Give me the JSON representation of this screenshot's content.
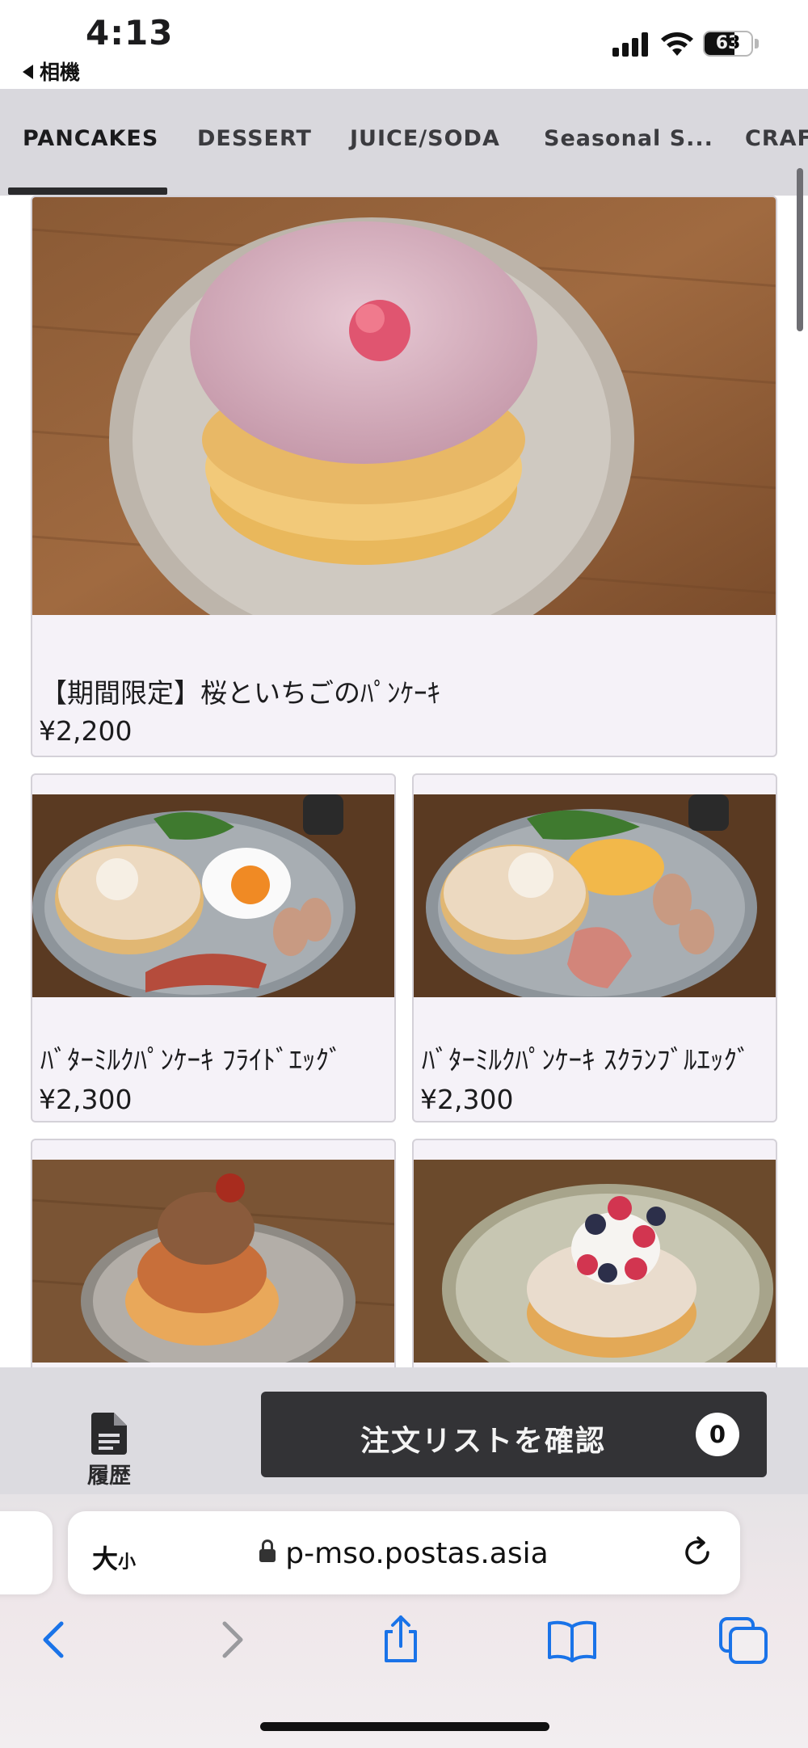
{
  "status": {
    "time": "4:13",
    "back_label": "相機",
    "battery": "63",
    "battery_level": 0.63
  },
  "tabs": [
    {
      "label": "PANCAKES",
      "active": true
    },
    {
      "label": "DESSERT",
      "active": false
    },
    {
      "label": "JUICE/SODA",
      "active": false
    },
    {
      "label": "Seasonal S...",
      "active": false
    },
    {
      "label": "CRAF",
      "active": false
    }
  ],
  "menu": {
    "featured": {
      "name": "【期間限定】桜といちごのﾊﾟﾝｹｰｷ",
      "price": "¥2,200"
    },
    "items": [
      {
        "name": "ﾊﾞﾀｰﾐﾙｸﾊﾟﾝｹｰｷ ﾌﾗｲﾄﾞｴｯｸﾞ",
        "price": "¥2,300"
      },
      {
        "name": "ﾊﾞﾀｰﾐﾙｸﾊﾟﾝｹｰｷ ｽｸﾗﾝﾌﾞﾙｴｯｸﾞ",
        "price": "¥2,300"
      },
      {
        "name": "",
        "price": ""
      },
      {
        "name": "",
        "price": ""
      }
    ]
  },
  "action_bar": {
    "history_label": "履歴",
    "order_label": "注文リストを確認",
    "order_count": "0"
  },
  "browser": {
    "text_size_big": "大",
    "text_size_small": "小",
    "url": "p-mso.postas.asia"
  },
  "colors": {
    "tab_bar_bg": "#d9d8dd",
    "order_button_bg": "#333336",
    "card_bg": "#f5f2f8",
    "safari_blue": "#1a73e8"
  }
}
